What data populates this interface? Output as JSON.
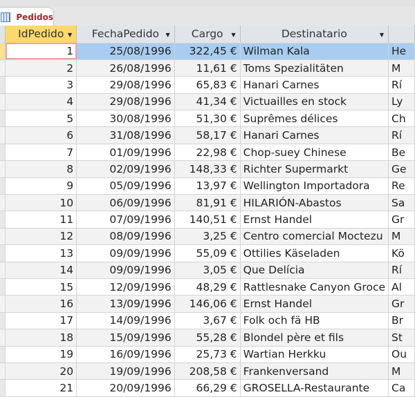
{
  "tab": {
    "label": "Pedidos",
    "icon": "table-icon"
  },
  "columns": [
    "IdPedido",
    "FechaPedido",
    "Cargo",
    "Destinatario",
    ""
  ],
  "rows": [
    [
      "1",
      "25/08/1996",
      "322,45 €",
      "Wilman Kala",
      "He"
    ],
    [
      "2",
      "26/08/1996",
      "11,61 €",
      "Toms Spezialitäten",
      "M"
    ],
    [
      "3",
      "29/08/1996",
      "65,83 €",
      "Hanari Carnes",
      "Rí"
    ],
    [
      "4",
      "29/08/1996",
      "41,34 €",
      "Victuailles en stock",
      "Ly"
    ],
    [
      "5",
      "30/08/1996",
      "51,30 €",
      "Suprêmes délices",
      "Ch"
    ],
    [
      "6",
      "31/08/1996",
      "58,17 €",
      "Hanari Carnes",
      "Rí"
    ],
    [
      "7",
      "01/09/1996",
      "22,98 €",
      "Chop-suey Chinese",
      "Be"
    ],
    [
      "8",
      "02/09/1996",
      "148,33 €",
      "Richter Supermarkt",
      "Ge"
    ],
    [
      "9",
      "05/09/1996",
      "13,97 €",
      "Wellington Importadora",
      "Re"
    ],
    [
      "10",
      "06/09/1996",
      "81,91 €",
      "HILARIÓN-Abastos",
      "Sa"
    ],
    [
      "11",
      "07/09/1996",
      "140,51 €",
      "Ernst Handel",
      "Gr"
    ],
    [
      "12",
      "08/09/1996",
      "3,25 €",
      "Centro comercial Moctezu",
      "M"
    ],
    [
      "13",
      "09/09/1996",
      "55,09 €",
      "Ottilies Käseladen",
      "Kö"
    ],
    [
      "14",
      "09/09/1996",
      "3,05 €",
      "Que Delícia",
      "Rí"
    ],
    [
      "15",
      "12/09/1996",
      "48,29 €",
      "Rattlesnake Canyon Groce",
      "Al"
    ],
    [
      "16",
      "13/09/1996",
      "146,06 €",
      "Ernst Handel",
      "Gr"
    ],
    [
      "17",
      "14/09/1996",
      "3,67 €",
      "Folk och fä HB",
      "Br"
    ],
    [
      "18",
      "15/09/1996",
      "55,28 €",
      "Blondel père et fils",
      "St"
    ],
    [
      "19",
      "16/09/1996",
      "25,73 €",
      "Wartian Herkku",
      "Ou"
    ],
    [
      "20",
      "19/09/1996",
      "208,58 €",
      "Frankenversand",
      "M"
    ],
    [
      "21",
      "20/09/1996",
      "66,29 €",
      "GROSELLA-Restaurante",
      "Ca"
    ]
  ]
}
